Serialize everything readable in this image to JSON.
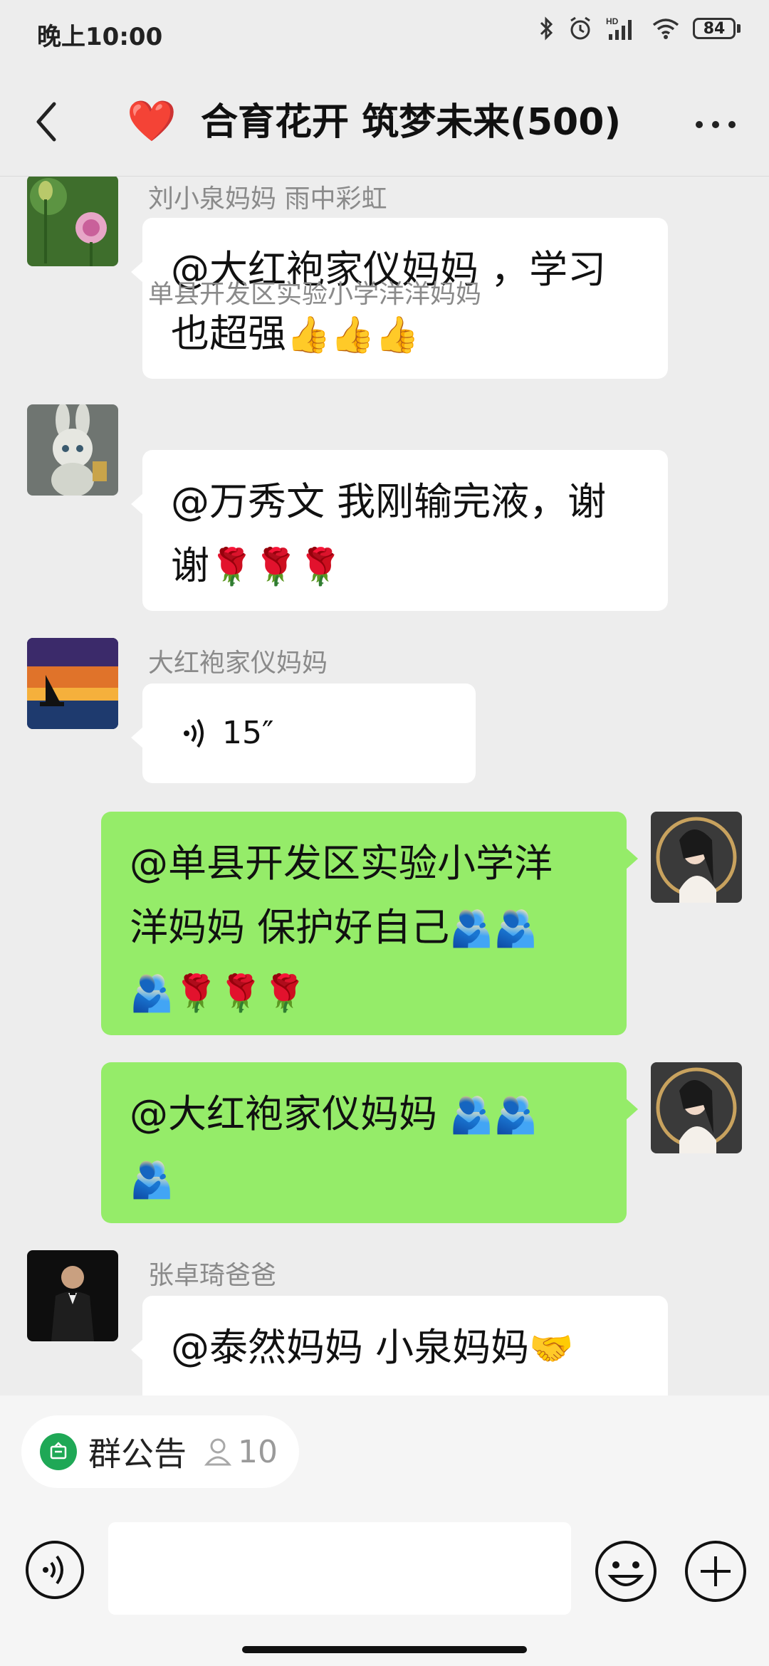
{
  "status_bar": {
    "time": "晚上10:00",
    "battery": "84",
    "network_label": "HD"
  },
  "header": {
    "title": "合育花开 筑梦未来(500)",
    "heart_emoji": "❤️"
  },
  "messages": [
    {
      "side": "left",
      "sender": "刘小泉妈妈  雨中彩虹",
      "text": "@大红袍家仪妈妈 ，学习",
      "text2": "也超强",
      "emojis": "👍👍👍",
      "avatar": "lotus-flower-avatar"
    },
    {
      "side": "left",
      "sender": "单县开发区实验小学洋洋妈妈",
      "text": "@万秀文  我刚输完液，谢",
      "text2": "谢",
      "emojis": "🌹🌹🌹",
      "avatar": "bunny-figure-avatar"
    },
    {
      "side": "left",
      "sender": "大红袍家仪妈妈",
      "voice_duration": "15″",
      "avatar": "sunset-sailboat-avatar"
    },
    {
      "side": "right",
      "text": "@单县开发区实验小学洋",
      "text2": "洋妈妈  保护好自己",
      "emojis_inline": "🫂🫂",
      "emojis_line3": "🫂🌹🌹🌹",
      "avatar": "girl-portrait-avatar"
    },
    {
      "side": "right",
      "text": "@大红袍家仪妈妈 ",
      "emojis_inline": "🫂🫂",
      "emojis_line2": "🫂",
      "avatar": "girl-portrait-avatar"
    },
    {
      "side": "left",
      "sender": "张卓琦爸爸",
      "text": "@泰然妈妈  小泉妈妈",
      "emojis": "🤝",
      "avatar": "man-in-suit-avatar"
    }
  ],
  "notice": {
    "label": "群公告",
    "count": "10"
  },
  "input": {
    "placeholder": ""
  },
  "colors": {
    "background": "#EDEDED",
    "self_bubble": "#95EC69",
    "other_bubble": "#FFFFFF",
    "notice_icon": "#1FA856",
    "heart": "#E0272A"
  }
}
